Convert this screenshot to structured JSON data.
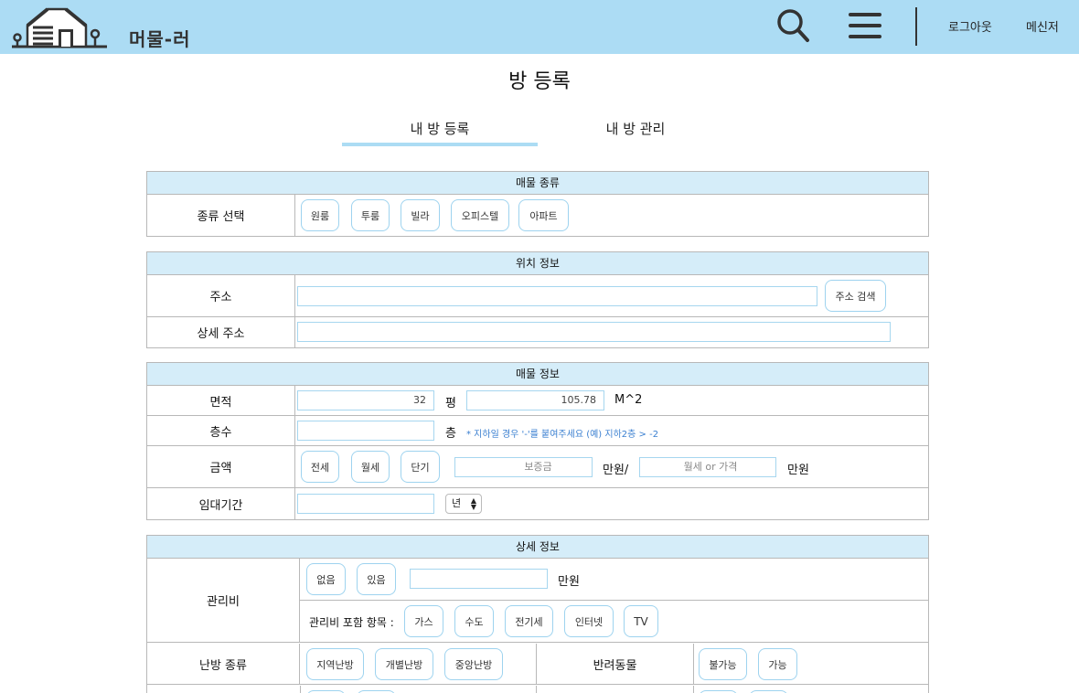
{
  "header": {
    "brand": "머물-러",
    "logout": "로그아웃",
    "messenger": "메신저"
  },
  "page": {
    "title": "방 등록",
    "tabs": [
      "내 방 등록",
      "내 방 관리"
    ]
  },
  "colors": {
    "header_bg": "#acdcf4",
    "section_head_bg": "#d5edf9",
    "button_border": "#9ed3ef",
    "note_text": "#3a7fd0"
  },
  "icons": [
    "house-logo-icon",
    "search-icon",
    "hamburger-menu-icon"
  ],
  "type_section": {
    "title": "매물 종류",
    "label": "종류 선택",
    "options": [
      "원룸",
      "투룸",
      "빌라",
      "오피스텔",
      "아파트"
    ]
  },
  "location_section": {
    "title": "위치 정보",
    "address_label": "주소",
    "address_value": "",
    "search_button": "주소 검색",
    "detail_label": "상세 주소",
    "detail_value": ""
  },
  "info_section": {
    "title": "매물 정보",
    "area_label": "면적",
    "area_pyeong": "32",
    "pyeong_unit": "평",
    "area_m2": "105.78",
    "m2_unit": "M^2",
    "floor_label": "층수",
    "floor_value": "",
    "floor_unit": "층",
    "floor_note": "* 지하일 경우 '-'를 붙여주세요 (예) 지하2층 > -2",
    "price_label": "금액",
    "price_types": [
      "전세",
      "월세",
      "단기"
    ],
    "deposit_placeholder": "보증금",
    "deposit_unit": "만원/",
    "rent_placeholder": "월세 or 가격",
    "rent_unit": "만원",
    "period_label": "임대기간",
    "period_value": "",
    "period_unit_selected": "년"
  },
  "detail_section": {
    "title": "상세 정보",
    "fee_label": "관리비",
    "fee_options": [
      "없음",
      "있음"
    ],
    "fee_value": "",
    "fee_unit": "만원",
    "fee_items_label": "관리비 포함 항목 :",
    "fee_items": [
      "가스",
      "수도",
      "전기세",
      "인터넷",
      "TV"
    ],
    "heating_label": "난방 종류",
    "heating_options": [
      "지역난방",
      "개별난방",
      "중앙난방"
    ],
    "pet_label": "반려동물",
    "pet_options": [
      "불가능",
      "가능"
    ]
  }
}
